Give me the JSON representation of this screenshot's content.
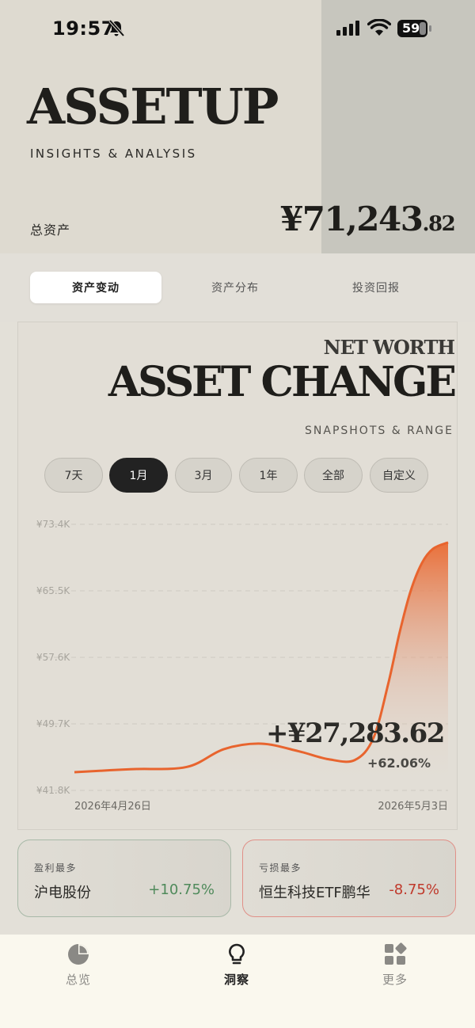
{
  "status": {
    "time": "19:57",
    "battery": "59"
  },
  "app": {
    "title": "ASSETUP",
    "tagline": "INSIGHTS & ANALYSIS"
  },
  "total": {
    "label": "总资产",
    "value_main": "¥71,243",
    "value_decimal": ".82"
  },
  "tabs": [
    {
      "label": "资产变动",
      "active": true
    },
    {
      "label": "资产分布",
      "active": false
    },
    {
      "label": "投资回报",
      "active": false
    }
  ],
  "card": {
    "kicker": "NET WORTH",
    "heading": "ASSET CHANGE",
    "subheading": "SNAPSHOTS & RANGE"
  },
  "ranges": [
    {
      "label": "7天",
      "active": false
    },
    {
      "label": "1月",
      "active": true
    },
    {
      "label": "3月",
      "active": false
    },
    {
      "label": "1年",
      "active": false
    },
    {
      "label": "全部",
      "active": false
    },
    {
      "label": "自定义",
      "active": false
    }
  ],
  "chart_data": {
    "type": "area",
    "y_ticks": [
      "¥73.4K",
      "¥65.5K",
      "¥57.6K",
      "¥49.7K",
      "¥41.8K"
    ],
    "ylim": [
      41800,
      73400
    ],
    "x_start_label": "2026年4月26日",
    "x_end_label": "2026年5月3日",
    "x": [
      0,
      0.15,
      0.3,
      0.4,
      0.5,
      0.6,
      0.68,
      0.75,
      0.8,
      0.84,
      0.87,
      0.9,
      0.93,
      0.96,
      1.0
    ],
    "values": [
      43960,
      44320,
      44580,
      46700,
      47350,
      46450,
      45500,
      45400,
      48000,
      54500,
      60500,
      65500,
      68800,
      70500,
      71244
    ],
    "change_value": "+¥27,283.62",
    "change_pct": "+62.06%",
    "line_color": "#e8642e",
    "grid": true
  },
  "movers": {
    "gainer": {
      "label": "盈利最多",
      "name": "沪电股份",
      "value": "+10.75%",
      "color": "#4f8a5b"
    },
    "loser": {
      "label": "亏损最多",
      "name": "恒生科技ETF鹏华",
      "value": "-8.75%",
      "color": "#c0392b"
    }
  },
  "nav": [
    {
      "label": "总览",
      "icon": "pie-chart-icon",
      "active": false
    },
    {
      "label": "洞察",
      "icon": "lightbulb-icon",
      "active": true
    },
    {
      "label": "更多",
      "icon": "grid-icon",
      "active": false
    }
  ]
}
